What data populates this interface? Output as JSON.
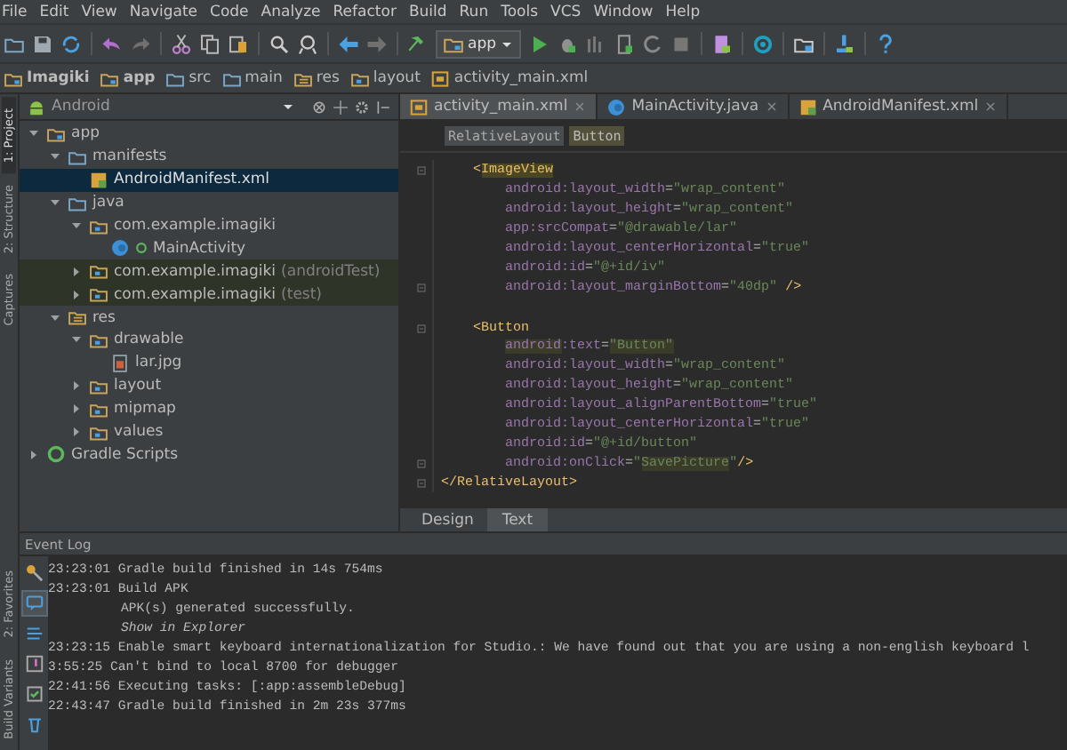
{
  "menu": [
    "File",
    "Edit",
    "View",
    "Navigate",
    "Code",
    "Analyze",
    "Refactor",
    "Build",
    "Run",
    "Tools",
    "VCS",
    "Window",
    "Help"
  ],
  "run_config": "app",
  "breadcrumb": [
    "Imagiki",
    "app",
    "src",
    "main",
    "res",
    "layout",
    "activity_main.xml"
  ],
  "side_tools_top": [
    {
      "label": "1: Project",
      "selected": true
    },
    {
      "label": "2: Structure",
      "selected": false
    },
    {
      "label": "Captures",
      "selected": false
    }
  ],
  "side_tools_bottom": [
    {
      "label": "2: Favorites",
      "selected": false
    },
    {
      "label": "Build Variants",
      "selected": false
    }
  ],
  "project": {
    "view": "Android",
    "tree": [
      {
        "label": "app",
        "kind": "module",
        "expanded": true,
        "selected": false,
        "children": [
          {
            "label": "manifests",
            "kind": "folder",
            "expanded": true,
            "selected": false,
            "children": [
              {
                "label": "AndroidManifest.xml",
                "kind": "manifest",
                "selected": true
              }
            ]
          },
          {
            "label": "java",
            "kind": "folder",
            "expanded": true,
            "selected": false,
            "children": [
              {
                "label": "com.example.imagiki",
                "kind": "package",
                "expanded": true,
                "selected": false,
                "tinted": false,
                "children": [
                  {
                    "label": "MainActivity",
                    "kind": "class",
                    "selected": false
                  }
                ]
              },
              {
                "label": "com.example.imagiki",
                "suffix": "(androidTest)",
                "kind": "package",
                "expanded": false,
                "selected": false,
                "tinted": true
              },
              {
                "label": "com.example.imagiki",
                "suffix": "(test)",
                "kind": "package",
                "expanded": false,
                "selected": false,
                "tinted": true
              }
            ]
          },
          {
            "label": "res",
            "kind": "res",
            "expanded": true,
            "selected": false,
            "children": [
              {
                "label": "drawable",
                "kind": "package",
                "expanded": true,
                "selected": false,
                "children": [
                  {
                    "label": "lar.jpg",
                    "kind": "image",
                    "selected": false
                  }
                ]
              },
              {
                "label": "layout",
                "kind": "package",
                "expanded": false,
                "selected": false
              },
              {
                "label": "mipmap",
                "kind": "package",
                "expanded": false,
                "selected": false
              },
              {
                "label": "values",
                "kind": "package",
                "expanded": false,
                "selected": false
              }
            ]
          }
        ]
      },
      {
        "label": "Gradle Scripts",
        "kind": "gradle",
        "expanded": false,
        "selected": false
      }
    ]
  },
  "editor_tabs": [
    {
      "label": "activity_main.xml",
      "kind": "xml",
      "selected": true
    },
    {
      "label": "MainActivity.java",
      "kind": "class",
      "selected": false
    },
    {
      "label": "AndroidManifest.xml",
      "kind": "manifest",
      "selected": false
    }
  ],
  "element_path": [
    {
      "label": "RelativeLayout",
      "selected": false
    },
    {
      "label": "Button",
      "selected": true
    }
  ],
  "code": [
    {
      "kind": "element",
      "fold": true,
      "tokens": [
        {
          "t": "<",
          "kind": "tag"
        },
        {
          "t": "ImageView",
          "kind": "tag",
          "hl": true
        }
      ]
    },
    {
      "kind": "attribute",
      "tokens": [
        {
          "t": "android:layout_width",
          "kind": "attr"
        },
        {
          "t": "=",
          "kind": "punct"
        },
        {
          "t": "\"wrap_content\"",
          "kind": "value"
        }
      ]
    },
    {
      "kind": "attribute",
      "tokens": [
        {
          "t": "android:layout_height",
          "kind": "attr"
        },
        {
          "t": "=",
          "kind": "punct"
        },
        {
          "t": "\"wrap_content\"",
          "kind": "value"
        }
      ]
    },
    {
      "kind": "attribute",
      "tokens": [
        {
          "t": "app:srcCompat",
          "kind": "attr"
        },
        {
          "t": "=",
          "kind": "punct"
        },
        {
          "t": "\"@drawable/lar\"",
          "kind": "value"
        }
      ]
    },
    {
      "kind": "attribute",
      "tokens": [
        {
          "t": "android:layout_centerHorizontal",
          "kind": "attr"
        },
        {
          "t": "=",
          "kind": "punct"
        },
        {
          "t": "\"true\"",
          "kind": "value"
        }
      ]
    },
    {
      "kind": "attribute",
      "tokens": [
        {
          "t": "android:id",
          "kind": "attr"
        },
        {
          "t": "=",
          "kind": "punct"
        },
        {
          "t": "\"@+id/iv\"",
          "kind": "value"
        }
      ]
    },
    {
      "kind": "attribute",
      "fold": true,
      "tokens": [
        {
          "t": "android:layout_marginBottom",
          "kind": "attr"
        },
        {
          "t": "=",
          "kind": "punct"
        },
        {
          "t": "\"40dp\"",
          "kind": "value"
        },
        {
          "t": " />",
          "kind": "tag"
        }
      ]
    },
    {
      "kind": "element",
      "fold": true,
      "tokens": [
        {
          "t": "<Button",
          "kind": "tag"
        }
      ]
    },
    {
      "kind": "attribute",
      "tokens": [
        {
          "t": "android",
          "kind": "attr",
          "hl": true
        },
        {
          "t": ":text",
          "kind": "attr"
        },
        {
          "t": "=",
          "kind": "punct"
        },
        {
          "t": "\"Button\"",
          "kind": "value",
          "hl": true
        }
      ]
    },
    {
      "kind": "attribute",
      "tokens": [
        {
          "t": "android:layout_width",
          "kind": "attr"
        },
        {
          "t": "=",
          "kind": "punct"
        },
        {
          "t": "\"wrap_content\"",
          "kind": "value"
        }
      ]
    },
    {
      "kind": "attribute",
      "tokens": [
        {
          "t": "android:layout_height",
          "kind": "attr"
        },
        {
          "t": "=",
          "kind": "punct"
        },
        {
          "t": "\"wrap_content\"",
          "kind": "value"
        }
      ]
    },
    {
      "kind": "attribute",
      "tokens": [
        {
          "t": "android:layout_alignParentBottom",
          "kind": "attr"
        },
        {
          "t": "=",
          "kind": "punct"
        },
        {
          "t": "\"true\"",
          "kind": "value"
        }
      ]
    },
    {
      "kind": "attribute",
      "tokens": [
        {
          "t": "android:layout_centerHorizontal",
          "kind": "attr"
        },
        {
          "t": "=",
          "kind": "punct"
        },
        {
          "t": "\"true\"",
          "kind": "value"
        }
      ]
    },
    {
      "kind": "attribute",
      "tokens": [
        {
          "t": "android:id",
          "kind": "attr"
        },
        {
          "t": "=",
          "kind": "punct"
        },
        {
          "t": "\"@+id/button\"",
          "kind": "value"
        }
      ]
    },
    {
      "kind": "attribute",
      "fold": true,
      "tokens": [
        {
          "t": "android:onClick",
          "kind": "attr"
        },
        {
          "t": "=",
          "kind": "punct"
        },
        {
          "t": "\"",
          "kind": "value"
        },
        {
          "t": "SavePicture",
          "kind": "value",
          "hl": true
        },
        {
          "t": "\"",
          "kind": "value"
        },
        {
          "t": "/>",
          "kind": "tag"
        }
      ]
    },
    {
      "kind": "closing",
      "fold": true,
      "tokens": [
        {
          "t": "</RelativeLayout>",
          "kind": "tag"
        }
      ]
    }
  ],
  "view_tabs": [
    {
      "label": "Design",
      "selected": false
    },
    {
      "label": "Text",
      "selected": true
    }
  ],
  "event_log": {
    "title": "Event Log",
    "entries": [
      {
        "kind": "entry",
        "text": "23:23:01 Gradle build finished in 14s 754ms"
      },
      {
        "kind": "entry",
        "text": "23:23:01 Build APK"
      },
      {
        "kind": "detail",
        "text": "APK(s) generated successfully."
      },
      {
        "kind": "link",
        "text": "Show in Explorer"
      },
      {
        "kind": "entry",
        "text": "23:23:15 Enable smart keyboard internationalization for Studio.: We have found out that you are using a non-english keyboard l"
      },
      {
        "kind": "entry",
        "text": "3:55:25 Can't bind to local 8700 for debugger"
      },
      {
        "kind": "entry",
        "text": "22:41:56 Executing tasks: [:app:assembleDebug]"
      },
      {
        "kind": "entry",
        "text": "22:43:47 Gradle build finished in 2m 23s 377ms"
      }
    ]
  }
}
